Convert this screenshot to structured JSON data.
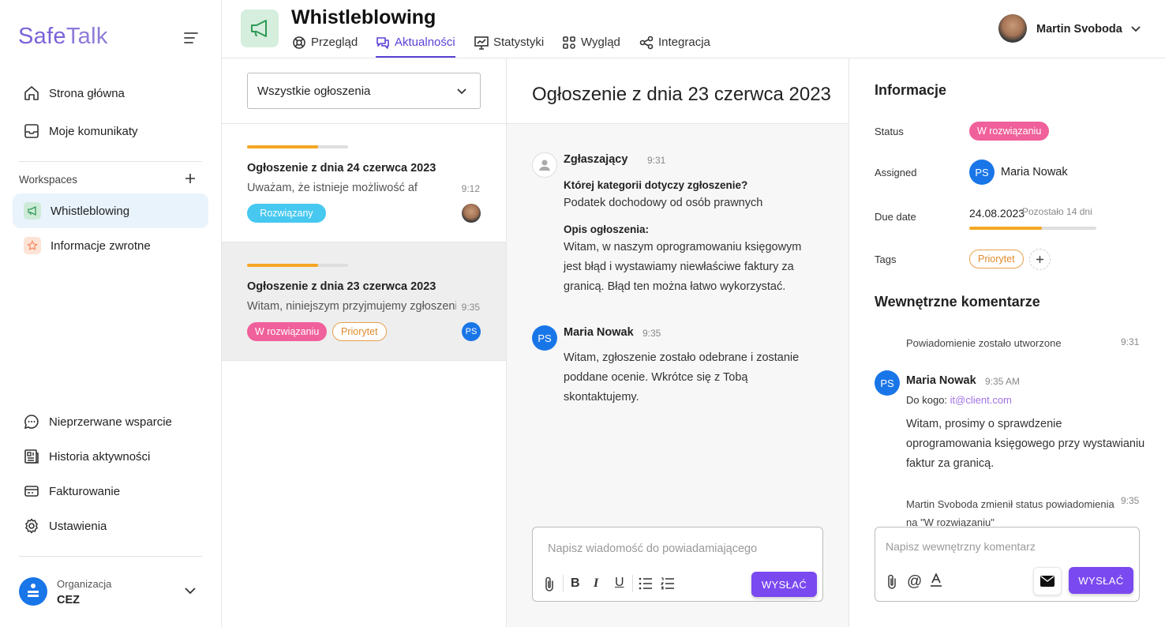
{
  "sidebar": {
    "logo_a": "Safe",
    "logo_b": "Talk",
    "nav": [
      {
        "label": "Strona główna",
        "icon": "home-icon"
      },
      {
        "label": "Moje komunikaty",
        "icon": "inbox-icon"
      }
    ],
    "workspaces_label": "Workspaces",
    "workspaces": [
      {
        "label": "Whistleblowing",
        "icon": "megaphone-icon",
        "active": true
      },
      {
        "label": "Informacje zwrotne",
        "icon": "star-icon",
        "active": false
      }
    ],
    "bottom_nav": [
      {
        "label": "Nieprzerwane wsparcie",
        "icon": "chat-icon"
      },
      {
        "label": "Historia aktywności",
        "icon": "history-icon"
      },
      {
        "label": "Fakturowanie",
        "icon": "credit-card-icon"
      },
      {
        "label": "Ustawienia",
        "icon": "gear-icon"
      }
    ],
    "org_label": "Organizacja",
    "org_name": "CEZ"
  },
  "header": {
    "title": "Whistleblowing",
    "tabs": [
      {
        "label": "Przegląd",
        "active": false
      },
      {
        "label": "Aktualności",
        "active": true
      },
      {
        "label": "Statystyki",
        "active": false
      },
      {
        "label": "Wygląd",
        "active": false
      },
      {
        "label": "Integracja",
        "active": false
      }
    ],
    "user_name": "Martin Svoboda"
  },
  "list": {
    "filter_value": "Wszystkie ogłoszenia",
    "cards": [
      {
        "title": "Ogłoszenie z dnia 24 czerwca 2023",
        "snippet": "Uważam, że istnieje możliwość af",
        "time": "9:12",
        "progress": 0.7,
        "badges": [
          "Rozwiązany"
        ]
      },
      {
        "title": "Ogłoszenie z dnia 23 czerwca 2023",
        "snippet": "Witam, niniejszym przyjmujemy zgłoszenie",
        "time": "9:35",
        "progress": 0.7,
        "badges": [
          "W rozwiązaniu",
          "Priorytet"
        ],
        "avatar": "PS"
      }
    ]
  },
  "messages": {
    "title": "Ogłoszenie z dnia 23 czerwca 2023",
    "reporter": {
      "name": "Zgłaszający",
      "time": "9:31",
      "q1": "Której kategorii dotyczy zgłoszenie?",
      "a1": "Podatek dochodowy od osób prawnych",
      "q2": "Opis ogłoszenia:",
      "a2_lines": [
        "Witam, w naszym oprogramowaniu księgowym",
        "jest błąd i wystawiamy niewłaściwe faktury za",
        "granicą. Błąd ten można łatwo wykorzystać."
      ]
    },
    "reply": {
      "avatar": "PS",
      "name": "Maria Nowak",
      "time": "9:35",
      "lines": [
        "Witam, zgłoszenie zostało odebrane i zostanie",
        "poddane ocenie. Wkrótce się z Tobą",
        "skontaktujemy."
      ]
    },
    "composer_placeholder": "Napisz wiadomość do powiadamiającego",
    "send_label": "WYSŁAĆ"
  },
  "info": {
    "title": "Informacje",
    "status_label": "Status",
    "status_value": "W rozwiązaniu",
    "assigned_label": "Assigned",
    "assigned_avatar": "PS",
    "assigned_name": "Maria Nowak",
    "due_label": "Due date",
    "due_value": "24.08.2023",
    "due_remaining": "Pozostało 14 dni",
    "due_progress": 0.57,
    "tags_label": "Tags",
    "tag": "Priorytet",
    "comments_title": "Wewnętrzne komentarze",
    "event1": "Powiadomienie zostało utworzone",
    "event1_time": "9:31",
    "comment": {
      "avatar": "PS",
      "name": "Maria Nowak",
      "time": "9:35 AM",
      "to_label": "Do kogo:",
      "to_email": "it@client.com",
      "lines": [
        "Witam, prosimy o sprawdzenie",
        "oprogramowania księgowego przy wystawianiu",
        "faktur za granicą."
      ]
    },
    "event2_lines": [
      "Martin Svoboda zmienił status powiadomienia",
      "na \"W rozwiązaniu\""
    ],
    "event2_time": "9:35",
    "composer_placeholder": "Napisz wewnętrzny komentarz",
    "send_label": "WYSŁAĆ"
  },
  "colors": {
    "accent": "#7b49f0",
    "status_resolved": "#46c8f0",
    "status_inprogress": "#f0609a",
    "priority": "#e8a04b",
    "progress": "#f5a623"
  }
}
